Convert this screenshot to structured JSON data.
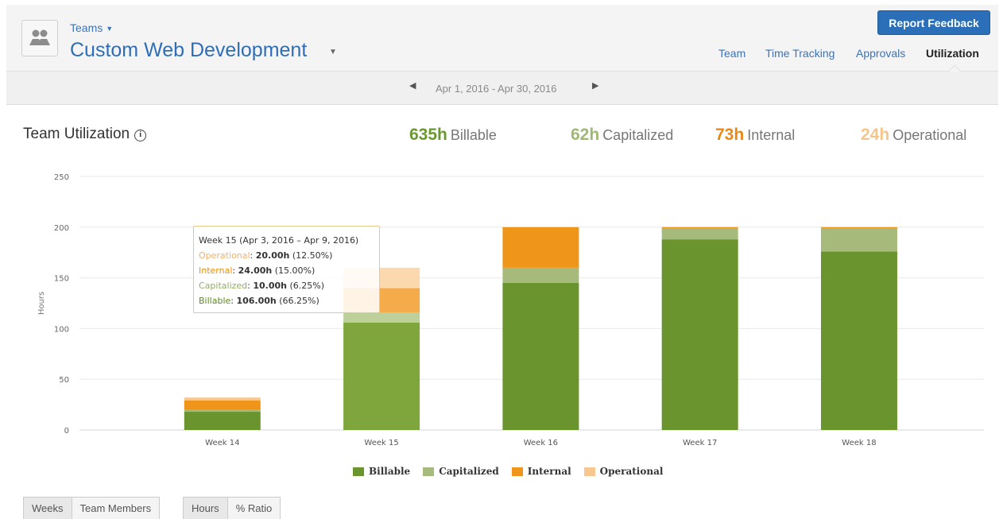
{
  "header": {
    "teams_label": "Teams",
    "team_name": "Custom Web Development",
    "report_button": "Report Feedback",
    "tabs": [
      {
        "label": "Team",
        "active": false
      },
      {
        "label": "Time Tracking",
        "active": false
      },
      {
        "label": "Approvals",
        "active": false
      },
      {
        "label": "Utilization",
        "active": true
      }
    ]
  },
  "date_bar": {
    "range": "Apr 1, 2016 - Apr 30, 2016"
  },
  "summary": {
    "title": "Team Utilization",
    "stats": [
      {
        "value": "635h",
        "label": "Billable",
        "color": "#6a9a2f"
      },
      {
        "value": "62h",
        "label": "Capitalized",
        "color": "#9fb872"
      },
      {
        "value": "73h",
        "label": "Internal",
        "color": "#ea8a14"
      },
      {
        "value": "24h",
        "label": "Operational",
        "color": "#f6c58a"
      }
    ]
  },
  "tooltip": {
    "title": "Week 15 (Apr 3, 2016 – Apr 9, 2016)",
    "lines": [
      {
        "name": "Operational",
        "value": "20.00h",
        "pct": "(12.50%)",
        "color": "#f4b167"
      },
      {
        "name": "Internal",
        "value": "24.00h",
        "pct": "(15.00%)",
        "color": "#e8900f"
      },
      {
        "name": "Capitalized",
        "value": "10.00h",
        "pct": "(6.25%)",
        "color": "#93ad63"
      },
      {
        "name": "Billable",
        "value": "106.00h",
        "pct": "(66.25%)",
        "color": "#5b8a25"
      }
    ]
  },
  "chart_data": {
    "type": "bar",
    "stacked": true,
    "categories": [
      "Week 14",
      "Week 15",
      "Week 16",
      "Week 17",
      "Week 18"
    ],
    "series": [
      {
        "name": "Billable",
        "values": [
          18,
          106,
          145,
          188,
          176
        ],
        "color": "#6a952e"
      },
      {
        "name": "Capitalized",
        "values": [
          2,
          10,
          15,
          11,
          23
        ],
        "color": "#a6bb7b"
      },
      {
        "name": "Internal",
        "values": [
          9,
          24,
          40,
          1,
          1
        ],
        "color": "#ef9519"
      },
      {
        "name": "Operational",
        "values": [
          3,
          20,
          0,
          0,
          0
        ],
        "color": "#f8c68f"
      }
    ],
    "highlight_category": "Week 15",
    "highlight_colors": [
      "#7fa63c",
      "#bdd09a",
      "#f5ab49",
      "#fbd8ae"
    ],
    "ylabel": "Hours",
    "ylim": [
      0,
      250
    ],
    "yticks": [
      0,
      50,
      100,
      150,
      200,
      250
    ],
    "grid": true,
    "legend": "bottom"
  },
  "controls": {
    "group_by": [
      {
        "label": "Weeks",
        "active": true
      },
      {
        "label": "Team Members",
        "active": false
      }
    ],
    "unit": [
      {
        "label": "Hours",
        "active": true
      },
      {
        "label": "% Ratio",
        "active": false
      }
    ]
  }
}
